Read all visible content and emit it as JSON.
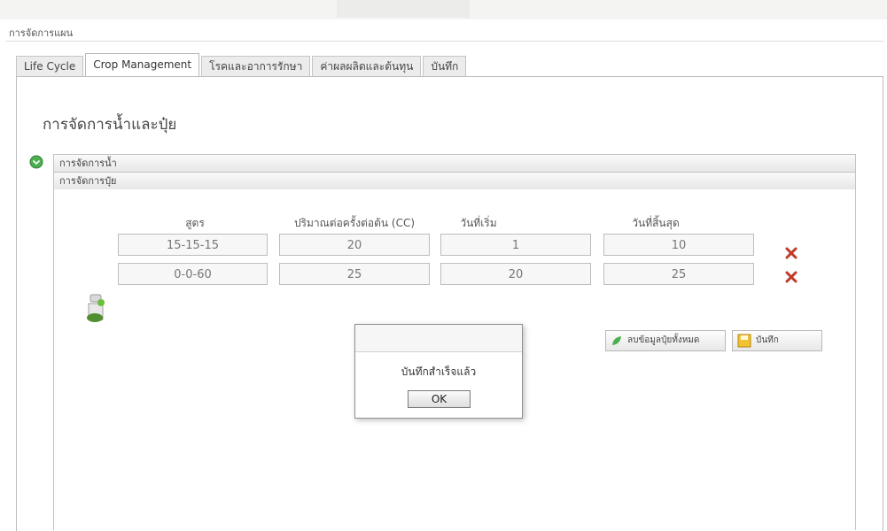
{
  "window": {
    "title": "การจัดการแผน"
  },
  "tabs": [
    {
      "label": "Life Cycle"
    },
    {
      "label": "Crop Management"
    },
    {
      "label": "โรคและอาการรักษา"
    },
    {
      "label": "ค่าผลผลิตและต้นทุน"
    },
    {
      "label": "บันทึก"
    }
  ],
  "section": {
    "title": "การจัดการน้ำและปุ๋ย"
  },
  "accordion": {
    "water": "การจัดการน้ำ",
    "fertilizer": "การจัดการปุ๋ย"
  },
  "fertilizer_table": {
    "headers": [
      "สูตร",
      "ปริมาณต่อครั้งต่อต้น (CC)",
      "วันที่เริ่ม",
      "วันที่สิ้นสุด"
    ],
    "rows": [
      {
        "formula": "15-15-15",
        "amount": "20",
        "start_day": "1",
        "end_day": "10"
      },
      {
        "formula": "0-0-60",
        "amount": "25",
        "start_day": "20",
        "end_day": "25"
      }
    ]
  },
  "buttons": {
    "apply_all": "ลบข้อมูลปุ๋ยทั้งหมด",
    "save": "บันทึก"
  },
  "dialog": {
    "message": "บันทึกสำเร็จแล้ว",
    "ok": "OK"
  },
  "colors": {
    "delete_icon": "#c0392b",
    "toggle_icon": "#3a9d3a"
  }
}
